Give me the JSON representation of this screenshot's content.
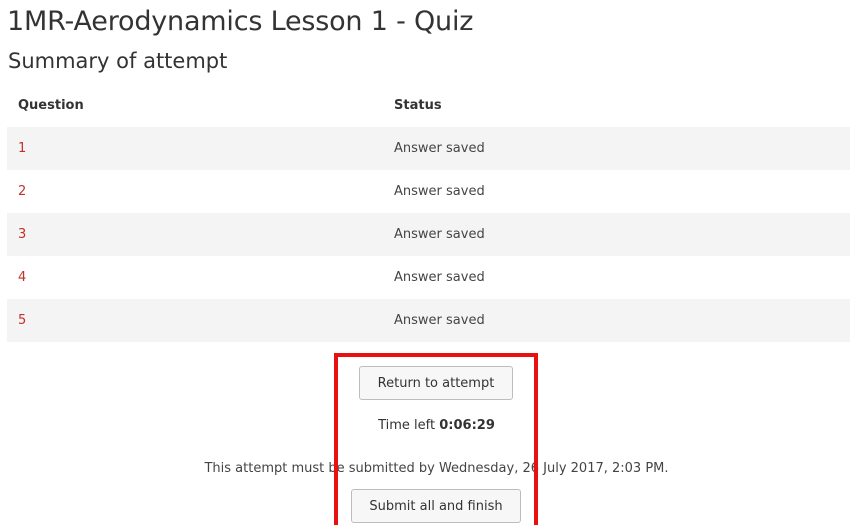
{
  "quiz": {
    "title": "1MR-Aerodynamics Lesson 1 - Quiz",
    "subtitle": "Summary of attempt"
  },
  "table": {
    "headers": {
      "question": "Question",
      "status": "Status"
    },
    "rows": [
      {
        "question": "1",
        "status": "Answer saved"
      },
      {
        "question": "2",
        "status": "Answer saved"
      },
      {
        "question": "3",
        "status": "Answer saved"
      },
      {
        "question": "4",
        "status": "Answer saved"
      },
      {
        "question": "5",
        "status": "Answer saved"
      }
    ]
  },
  "actions": {
    "return_label": "Return to attempt",
    "time_left_label": "Time left",
    "time_left_value": "0:06:29",
    "deadline_text": "This attempt must be submitted by Wednesday, 26 July 2017, 2:03 PM.",
    "submit_label": "Submit all and finish"
  },
  "colors": {
    "link": "#c4302b",
    "highlight": "#e81010",
    "row_stripe": "#f4f4f4"
  }
}
